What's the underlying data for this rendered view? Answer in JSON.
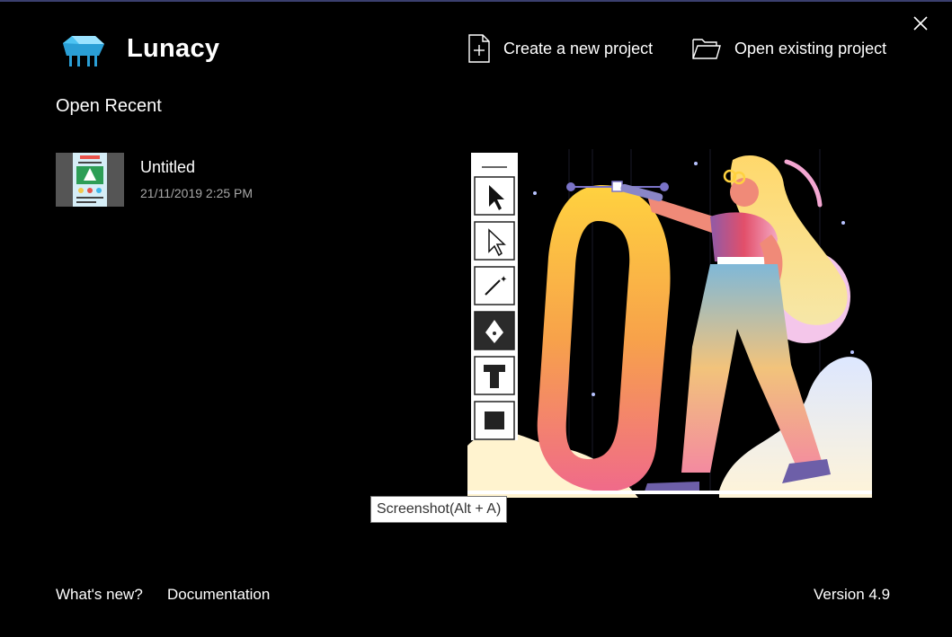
{
  "app": {
    "name": "Lunacy",
    "logo_icon": "lunacy-logo-icon"
  },
  "header": {
    "create_label": "Create a new project",
    "open_label": "Open existing project",
    "close_icon": "close-icon"
  },
  "recent": {
    "title": "Open Recent",
    "items": [
      {
        "name": "Untitled",
        "date": "21/11/2019 2:25 PM"
      }
    ]
  },
  "tooltip": {
    "text": "Screenshot(Alt + A)"
  },
  "footer": {
    "whats_new": "What's new?",
    "documentation": "Documentation",
    "version": "Version 4.9"
  },
  "colors": {
    "background": "#000000",
    "accent": "#3a3f6e",
    "logo": "#3fb7ea"
  }
}
